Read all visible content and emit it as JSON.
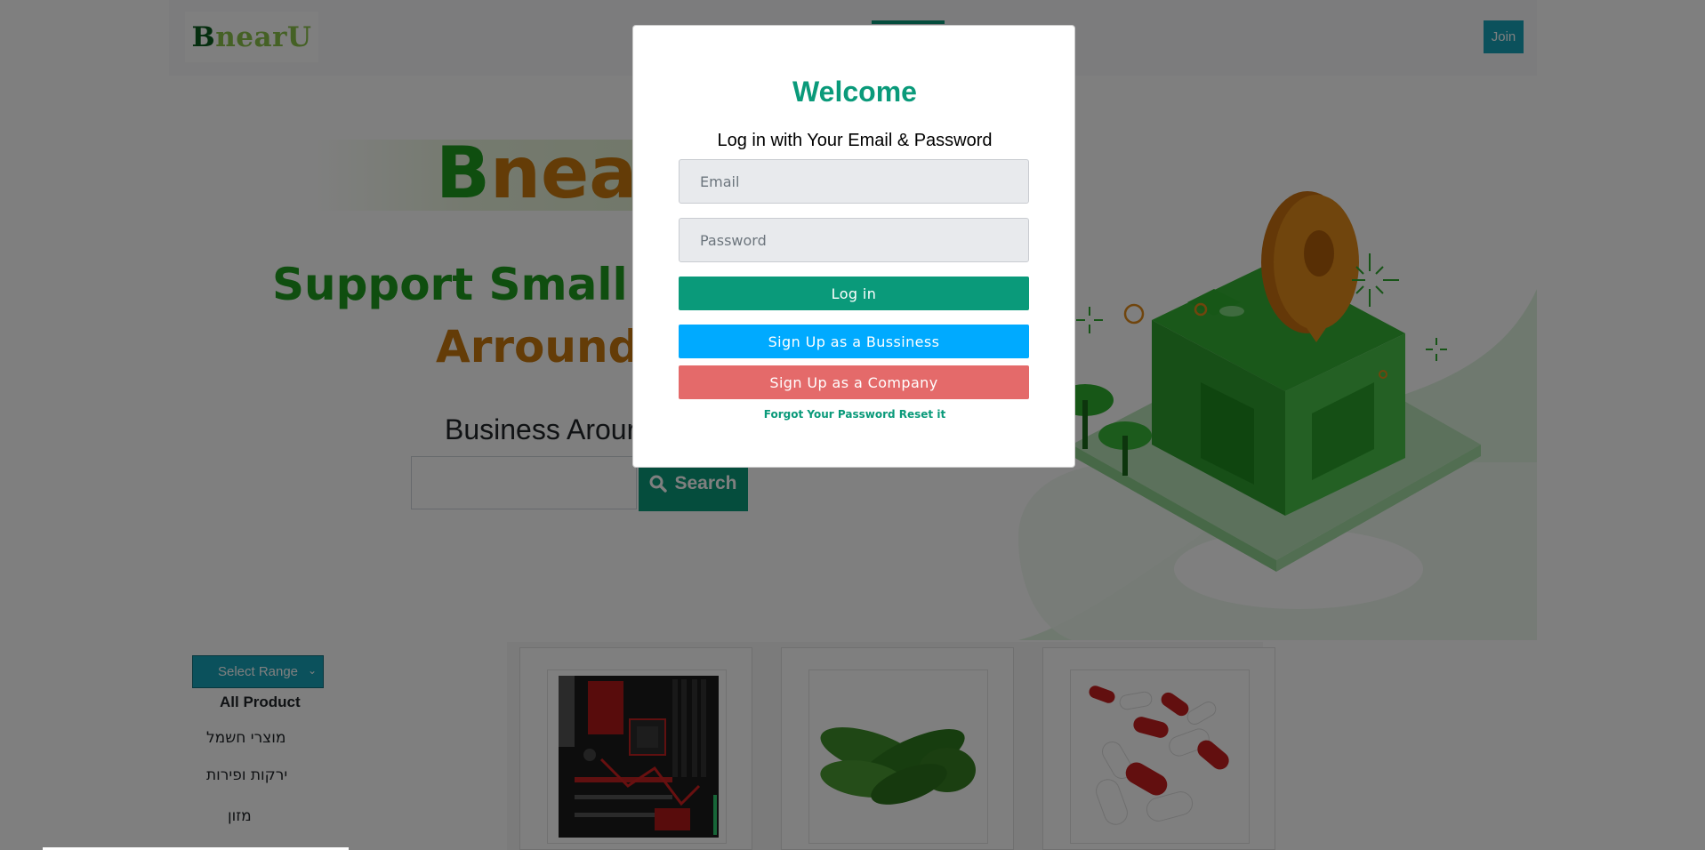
{
  "navbar": {
    "logo_b": "B",
    "logo_rest": "nearU",
    "join_label": "Join"
  },
  "hero": {
    "brand_b": "B",
    "brand_rest": "nea",
    "tagline_line1": "Support Small B",
    "tagline_line2": "Arround",
    "around_title": "Business Arour",
    "search_label": "Search"
  },
  "filters": {
    "range_select_value": "Select Range",
    "categories": [
      {
        "label": "All Product"
      },
      {
        "label": "מוצרי חשמל"
      },
      {
        "label": "ירקות ופירות"
      },
      {
        "label": "מזון"
      }
    ]
  },
  "products": [
    {
      "name": "motherboard"
    },
    {
      "name": "cucumbers"
    },
    {
      "name": "capsules"
    }
  ],
  "modal": {
    "title": "Welcome",
    "subtitle": "Log in with Your Email & Password",
    "email_placeholder": "Email",
    "password_placeholder": "Password",
    "login_label": "Log in",
    "signup_business_label": "Sign Up as a Bussiness",
    "signup_company_label": "Sign Up as a Company",
    "forgot_label": "Forgot Your Password Reset it"
  },
  "colors": {
    "primary_green": "#0a9a7a",
    "brand_green": "#1f9d1f",
    "brand_orange": "#c8780e",
    "business_blue": "#00aaff",
    "company_red": "#e46a6a",
    "info_teal": "#17a2b8"
  }
}
